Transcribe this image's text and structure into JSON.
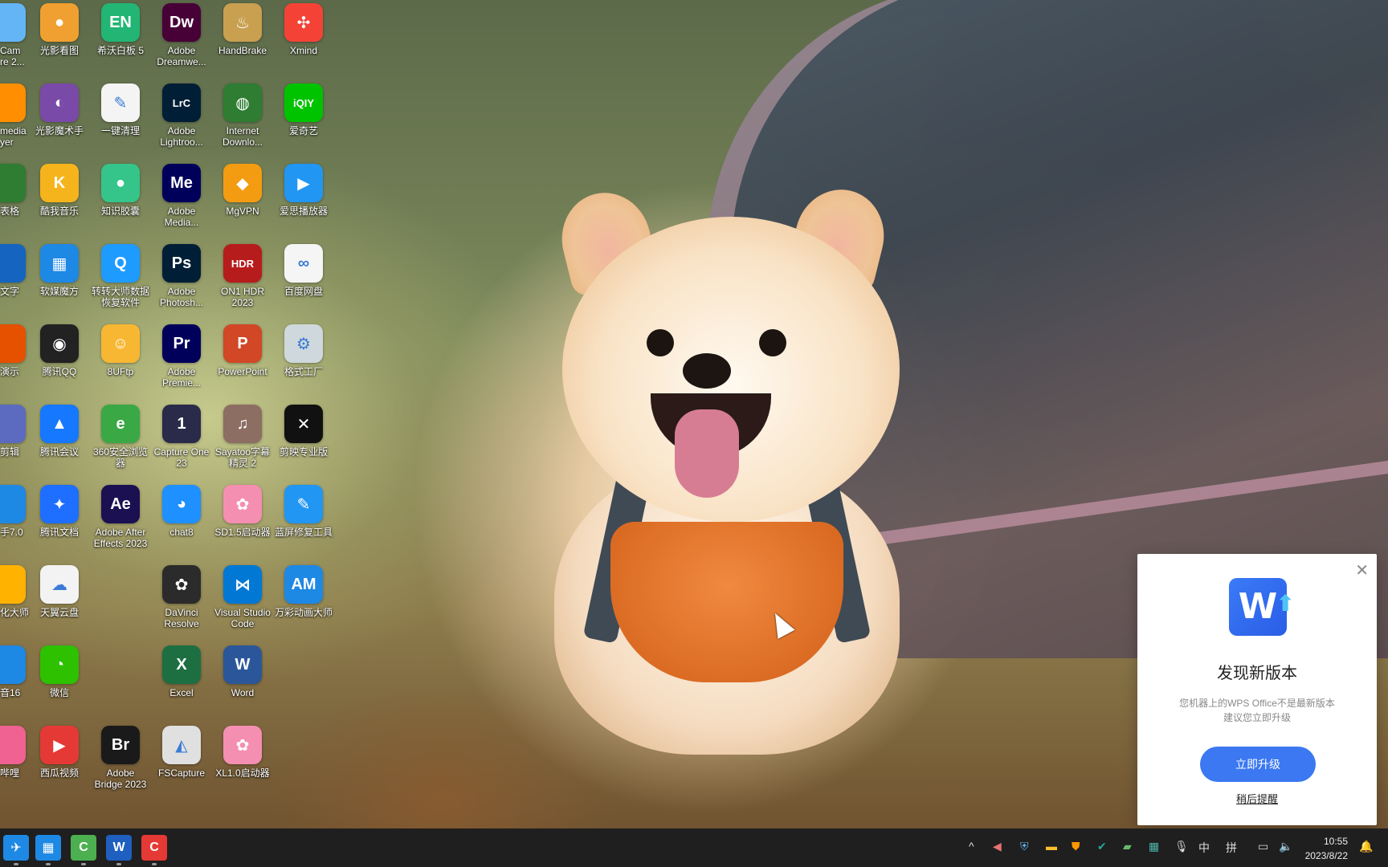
{
  "desktop": {
    "columns": [
      {
        "items": [
          {
            "label": "光影看图",
            "icon": "photo-viewer-icon",
            "glyph": "●",
            "color": "#f0a030"
          },
          {
            "label": "光影魔术手",
            "icon": "color-wheel-icon",
            "glyph": "◐",
            "color": "#7a4aa8"
          },
          {
            "label": "酷我音乐",
            "icon": "music-icon",
            "glyph": "K",
            "color": "#f6b41c"
          },
          {
            "label": "软媒魔方",
            "icon": "cube-icon",
            "glyph": "▦",
            "color": "#1e88e5"
          },
          {
            "label": "腾讯QQ",
            "icon": "penguin-icon",
            "glyph": "◉",
            "color": "#222222"
          },
          {
            "label": "腾讯会议",
            "icon": "meeting-icon",
            "glyph": "▲",
            "color": "#1677ff"
          },
          {
            "label": "腾讯文档",
            "icon": "docs-icon",
            "glyph": "✦",
            "color": "#1e6fff"
          },
          {
            "label": "天翼云盘",
            "icon": "cloud-icon",
            "glyph": "☁",
            "color": "#f3f3f3"
          },
          {
            "label": "微信",
            "icon": "wechat-icon",
            "glyph": "◔",
            "color": "#2dc100"
          },
          {
            "label": "西瓜视频",
            "icon": "video-icon",
            "glyph": "▶",
            "color": "#e53935"
          }
        ]
      },
      {
        "items": [
          {
            "label": "希沃白板 5",
            "icon": "whiteboard-icon",
            "glyph": "EN",
            "color": "#22b573"
          },
          {
            "label": "一键清理",
            "icon": "broom-icon",
            "glyph": "✎",
            "color": "#f4f4f4"
          },
          {
            "label": "知识胶囊",
            "icon": "capsule-icon",
            "glyph": "●",
            "color": "#35c48a"
          },
          {
            "label": "转转大师数据\n恢复软件",
            "icon": "recovery-icon",
            "glyph": "Q",
            "color": "#1e9bff"
          },
          {
            "label": "8UFtp",
            "icon": "ftp-icon",
            "glyph": "☺",
            "color": "#f7b733"
          },
          {
            "label": "360安全浏览\n器",
            "icon": "browser-icon",
            "glyph": "e",
            "color": "#3aa845"
          },
          {
            "label": "Adobe After\nEffects 2023",
            "icon": "after-effects-icon",
            "glyph": "Ae",
            "color": "#1a1052"
          },
          {
            "label": "",
            "icon": "",
            "glyph": "",
            "color": ""
          },
          {
            "label": "",
            "icon": "",
            "glyph": "",
            "color": ""
          },
          {
            "label": "Adobe\nBridge 2023",
            "icon": "bridge-icon",
            "glyph": "Br",
            "color": "#1a1a1a"
          }
        ]
      },
      {
        "items": [
          {
            "label": "Adobe\nDreamwe...",
            "icon": "dreamweaver-icon",
            "glyph": "Dw",
            "color": "#470137"
          },
          {
            "label": "Adobe\nLightroo...",
            "icon": "lightroom-icon",
            "glyph": "LrC",
            "color": "#001e36"
          },
          {
            "label": "Adobe\nMedia...",
            "icon": "media-encoder-icon",
            "glyph": "Me",
            "color": "#00005b"
          },
          {
            "label": "Adobe\nPhotosh...",
            "icon": "photoshop-icon",
            "glyph": "Ps",
            "color": "#001e36"
          },
          {
            "label": "Adobe\nPremie...",
            "icon": "premiere-icon",
            "glyph": "Pr",
            "color": "#00005b"
          },
          {
            "label": "Capture One\n23",
            "icon": "capture-one-icon",
            "glyph": "1",
            "color": "#2a2a4a"
          },
          {
            "label": "chat8",
            "icon": "chat-icon",
            "glyph": "◕",
            "color": "#1e90ff"
          },
          {
            "label": "DaVinci\nResolve",
            "icon": "davinci-icon",
            "glyph": "✿",
            "color": "#2b2b2b"
          },
          {
            "label": "Excel",
            "icon": "excel-icon",
            "glyph": "X",
            "color": "#1d6f42"
          },
          {
            "label": "FSCapture",
            "icon": "fscapture-icon",
            "glyph": "◭",
            "color": "#e0e0e0"
          }
        ]
      },
      {
        "items": [
          {
            "label": "HandBrake",
            "icon": "handbrake-icon",
            "glyph": "♨",
            "color": "#c8a050"
          },
          {
            "label": "Internet\nDownlo...",
            "icon": "idm-icon",
            "glyph": "◍",
            "color": "#2e7d32"
          },
          {
            "label": "MgVPN",
            "icon": "vpn-icon",
            "glyph": "◆",
            "color": "#f39c12"
          },
          {
            "label": "ON1 HDR\n2023",
            "icon": "hdr-icon",
            "glyph": "HDR",
            "color": "#b71c1c"
          },
          {
            "label": "PowerPoint",
            "icon": "powerpoint-icon",
            "glyph": "P",
            "color": "#d24726"
          },
          {
            "label": "Sayatoo字幕\n精灵 2",
            "icon": "subtitle-icon",
            "glyph": "♫",
            "color": "#8d6e63"
          },
          {
            "label": "SD1.5启动器",
            "icon": "sd-launcher-icon",
            "glyph": "✿",
            "color": "#f48fb1"
          },
          {
            "label": "Visual Studio\nCode",
            "icon": "vscode-icon",
            "glyph": "⋈",
            "color": "#0078d4"
          },
          {
            "label": "Word",
            "icon": "word-icon",
            "glyph": "W",
            "color": "#2b579a"
          },
          {
            "label": "XL1.0启动器",
            "icon": "xl-launcher-icon",
            "glyph": "✿",
            "color": "#f48fb1"
          }
        ]
      },
      {
        "items": [
          {
            "label": "Xmind",
            "icon": "xmind-icon",
            "glyph": "✣",
            "color": "#f44336"
          },
          {
            "label": "爱奇艺",
            "icon": "iqiyi-icon",
            "glyph": "iQIY",
            "color": "#00c300"
          },
          {
            "label": "爱思播放器",
            "icon": "player-icon",
            "glyph": "▶",
            "color": "#2196f3"
          },
          {
            "label": "百度网盘",
            "icon": "baidu-pan-icon",
            "glyph": "∞",
            "color": "#f5f5f5"
          },
          {
            "label": "格式工厂",
            "icon": "format-factory-icon",
            "glyph": "⚙",
            "color": "#cfd8dc"
          },
          {
            "label": "剪映专业版",
            "icon": "capcut-icon",
            "glyph": "✕",
            "color": "#111111"
          },
          {
            "label": "蓝屏修复工具",
            "icon": "wrench-icon",
            "glyph": "✎",
            "color": "#2196f3"
          },
          {
            "label": "万彩动画大师",
            "icon": "animation-icon",
            "glyph": "AM",
            "color": "#1e88e5"
          },
          {
            "label": "",
            "icon": "",
            "glyph": "",
            "color": ""
          },
          {
            "label": "",
            "icon": "",
            "glyph": "",
            "color": ""
          }
        ]
      }
    ],
    "partial_left": [
      {
        "label": "Cam\nre 2...",
        "color": "#64b5f6"
      },
      {
        "label": "media\nyer",
        "color": "#ff8f00"
      },
      {
        "label": "表格",
        "color": "#2e7d32"
      },
      {
        "label": "文字",
        "color": "#1565c0"
      },
      {
        "label": "演示",
        "color": "#e65100"
      },
      {
        "label": "剪辑",
        "color": "#5c6bc0"
      },
      {
        "label": "手7.0",
        "color": "#1e88e5"
      },
      {
        "label": "化大师",
        "color": "#ffb300"
      },
      {
        "label": "音16",
        "color": "#1e88e5"
      },
      {
        "label": "哔哩",
        "color": "#f06292"
      }
    ]
  },
  "wps_popup": {
    "logo_glyph": "W",
    "title": "发现新版本",
    "desc_line1": "您机器上的WPS Office不是最新版本",
    "desc_line2": "建议您立即升级",
    "upgrade_label": "立即升级",
    "later_label": "稍后提醒",
    "close_glyph": "✕"
  },
  "taskbar": {
    "apps": [
      {
        "name": "taskbar-app-1",
        "glyph": "✈",
        "color": "#1e88e5"
      },
      {
        "name": "taskbar-app-2",
        "glyph": "▦",
        "color": "#1e88e5"
      },
      {
        "name": "taskbar-app-3",
        "glyph": "C",
        "color": "#4caf50"
      },
      {
        "name": "taskbar-app-4",
        "glyph": "W",
        "color": "#1e5fbf"
      },
      {
        "name": "taskbar-app-5",
        "glyph": "C",
        "color": "#e53935"
      }
    ],
    "tray": {
      "chevron": "^",
      "ime_lang": "中",
      "ime_mode": "拼"
    },
    "clock_time": "10:55",
    "clock_date": "2023/8/22"
  },
  "colors": {
    "taskbar_bg": "#1f1f1f",
    "popup_accent": "#3b78f1"
  }
}
